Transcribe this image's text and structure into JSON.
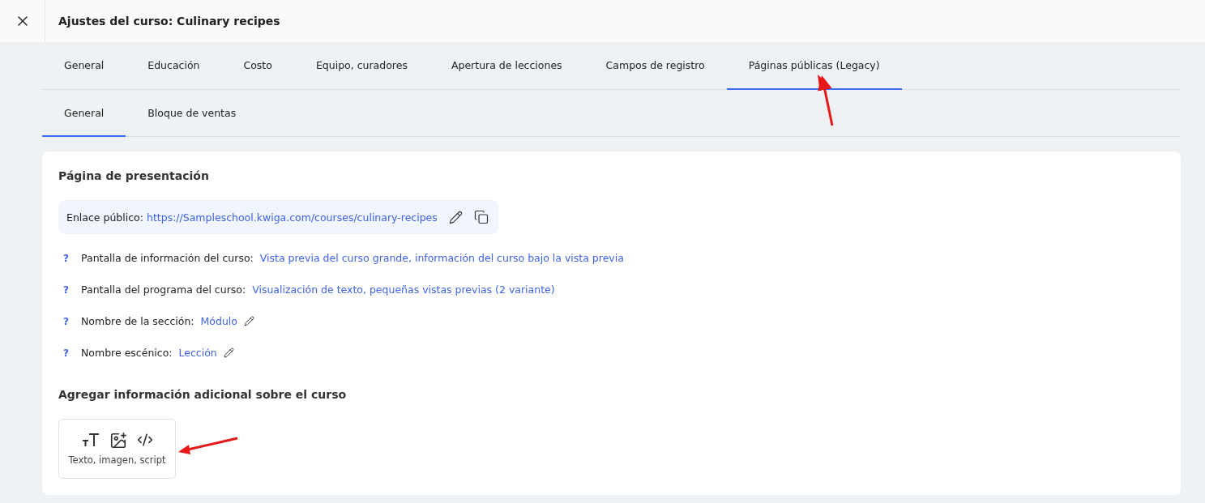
{
  "header": {
    "title": "Ajustes del curso: Culinary recipes"
  },
  "tabs": [
    {
      "label": "General",
      "selected": false
    },
    {
      "label": "Educación",
      "selected": false
    },
    {
      "label": "Costo",
      "selected": false
    },
    {
      "label": "Equipo, curadores",
      "selected": false
    },
    {
      "label": "Apertura de lecciones",
      "selected": false
    },
    {
      "label": "Campos de registro",
      "selected": false
    },
    {
      "label": "Páginas públicas (Legacy)",
      "selected": true
    }
  ],
  "subtabs": [
    {
      "label": "General",
      "selected": true
    },
    {
      "label": "Bloque de ventas",
      "selected": false
    }
  ],
  "card": {
    "title": "Página de presentación",
    "public_link": {
      "label": "Enlace público:",
      "url": "https://Sampleschool.kwiga.com/courses/culinary-recipes"
    },
    "settings": [
      {
        "help": "?",
        "label": "Pantalla de información del curso:",
        "value": "Vista previa del curso grande, información del curso bajo la vista previa",
        "editable": false
      },
      {
        "help": "?",
        "label": "Pantalla del programa del curso:",
        "value": "Visualización de texto, pequeñas vistas previas (2 variante)",
        "editable": false
      },
      {
        "help": "?",
        "label": "Nombre de la sección:",
        "value": "Módulo",
        "editable": true
      },
      {
        "help": "?",
        "label": "Nombre escénico:",
        "value": "Lección",
        "editable": true
      }
    ],
    "additional_title": "Agregar información adicional sobre el curso",
    "add_block": {
      "label": "Texto, imagen, script"
    }
  }
}
